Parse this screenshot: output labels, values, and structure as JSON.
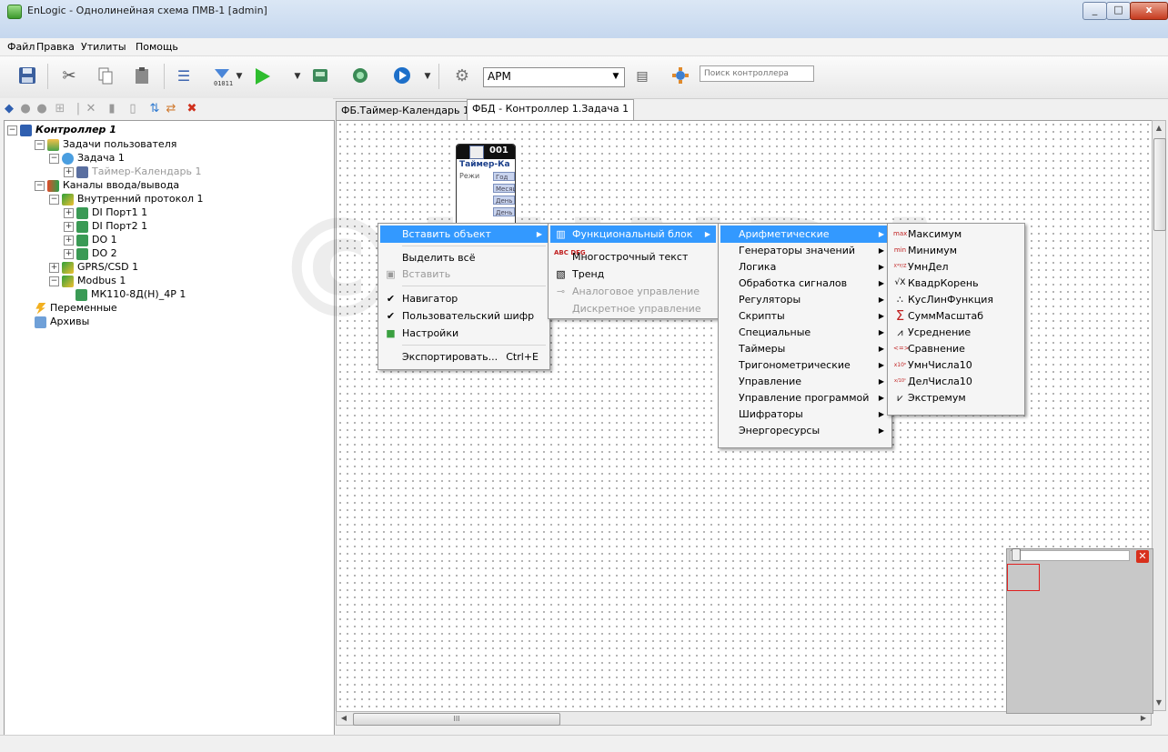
{
  "window": {
    "title": "EnLogic - Однолинейная схема ПМВ-1 [admin]",
    "close_glyph": "x",
    "min_glyph": "_",
    "max_glyph": "□"
  },
  "menubar": [
    "Файл",
    "Правка",
    "Утилиты",
    "Помощь"
  ],
  "toolbar": {
    "apm_value": "АРМ",
    "search_placeholder": "Поиск контроллера"
  },
  "tabs": [
    {
      "label": "ФБ.Таймер-Календарь 1",
      "active": false
    },
    {
      "label": "ФБД - Контроллер 1.Задача 1",
      "active": true
    }
  ],
  "tree": {
    "controller": "Контроллер 1",
    "user_tasks": "Задачи пользователя",
    "task1": "Задача 1",
    "timer_calendar": "Таймер-Календарь 1",
    "io_channels": "Каналы ввода/вывода",
    "internal_protocol": "Внутренний протокол 1",
    "di_port1": "DI Порт1 1",
    "di_port2": "DI Порт2 1",
    "do1": "DO 1",
    "do2": "DO 2",
    "gprs": "GPRS/CSD 1",
    "modbus": "Modbus 1",
    "mk110": "МК110-8Д(Н)_4Р 1",
    "variables": "Переменные",
    "archives": "Архивы"
  },
  "function_block": {
    "number": "001",
    "name": "Таймер-Ка",
    "input": "Режи",
    "outputs": [
      "Год",
      "Месяц",
      "День",
      "День"
    ]
  },
  "context_menu": {
    "insert_object": "Вставить объект",
    "select_all": "Выделить всё",
    "paste": "Вставить",
    "navigator": "Навигатор",
    "user_cipher": "Пользовательский шифр",
    "settings": "Настройки",
    "export": "Экспортировать...",
    "export_shortcut": "Ctrl+E"
  },
  "insert_submenu": {
    "function_block": "Функциональный блок",
    "multiline_text": "Многострочный текст",
    "trend": "Тренд",
    "analog_control": "Аналоговое управление",
    "discrete_control": "Дискретное управление"
  },
  "categories": [
    "Арифметические",
    "Генераторы значений",
    "Логика",
    "Обработка сигналов",
    "Регуляторы",
    "Скрипты",
    "Специальные",
    "Таймеры",
    "Тригонометрические",
    "Управление",
    "Управление программой",
    "Шифраторы",
    "Энергоресурсы"
  ],
  "arithmetic": [
    {
      "label": "Максимум",
      "icon": "max"
    },
    {
      "label": "Минимум",
      "icon": "min"
    },
    {
      "label": "УмнДел",
      "icon": "X*Y/Z"
    },
    {
      "label": "КвадрКорень",
      "icon": "√X"
    },
    {
      "label": "КусЛинФункция",
      "icon": "∴"
    },
    {
      "label": "СуммМасштаб",
      "icon": "Σ"
    },
    {
      "label": "Усреднение",
      "icon": "⩘"
    },
    {
      "label": "Сравнение",
      "icon": "<=>"
    },
    {
      "label": "УмнЧисла10",
      "icon": "x10ⁿ"
    },
    {
      "label": "ДелЧисла10",
      "icon": "x/10ⁿ"
    },
    {
      "label": "Экстремум",
      "icon": "⩗"
    }
  ],
  "hscroll_grip": "III",
  "watermark": "©LUNDA",
  "colors": {
    "menu_highlight": "#3399ff",
    "minimap_close": "#d8301c"
  }
}
